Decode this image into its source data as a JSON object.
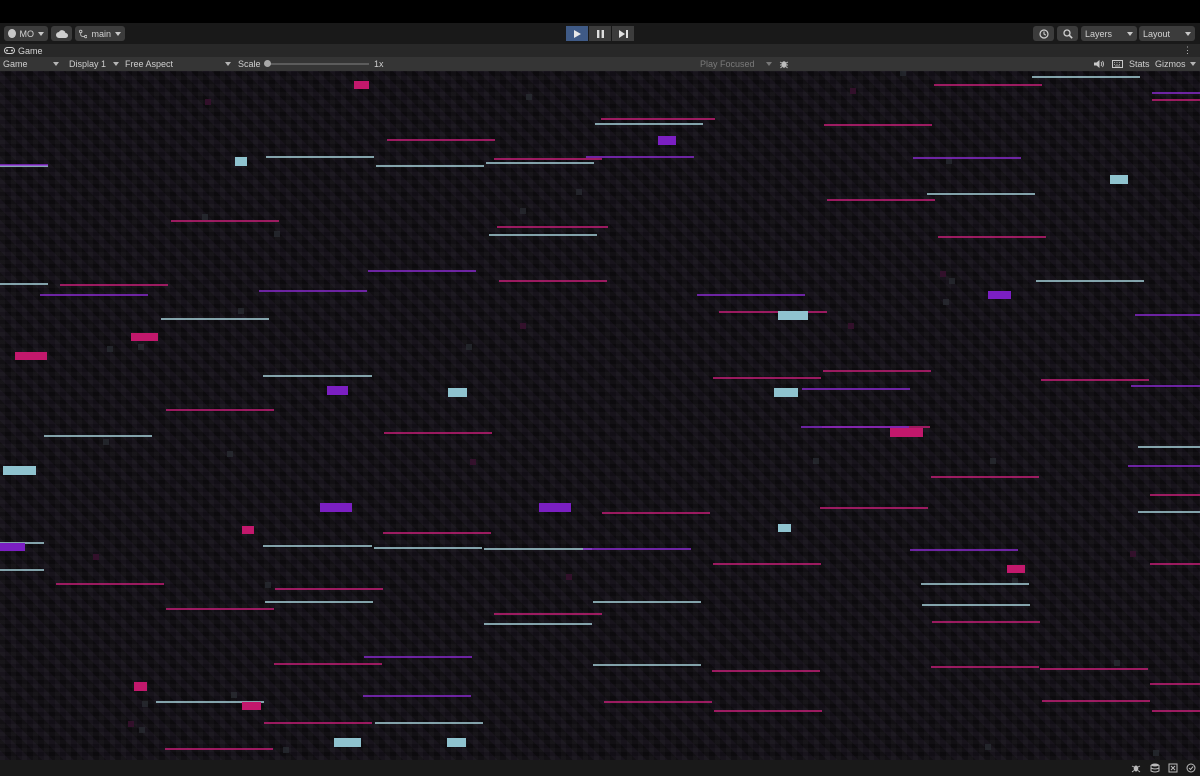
{
  "toolbar": {
    "account_label": "MO",
    "branch_label": "main",
    "layers_label": "Layers",
    "layout_label": "Layout"
  },
  "game_tab": {
    "title": "Game"
  },
  "game_toolbar": {
    "view_mode": "Game",
    "display": "Display 1",
    "aspect": "Free Aspect",
    "scale_label": "Scale",
    "scale_value": "1x",
    "play_mode": "Play Focused",
    "stats_label": "Stats",
    "gizmos_label": "Gizmos"
  },
  "viewport": {
    "colors": {
      "background": "#0e0c10",
      "magenta": "#c2186c",
      "purple": "#7b1fc2",
      "lightblue": "#8fc3cf"
    }
  }
}
